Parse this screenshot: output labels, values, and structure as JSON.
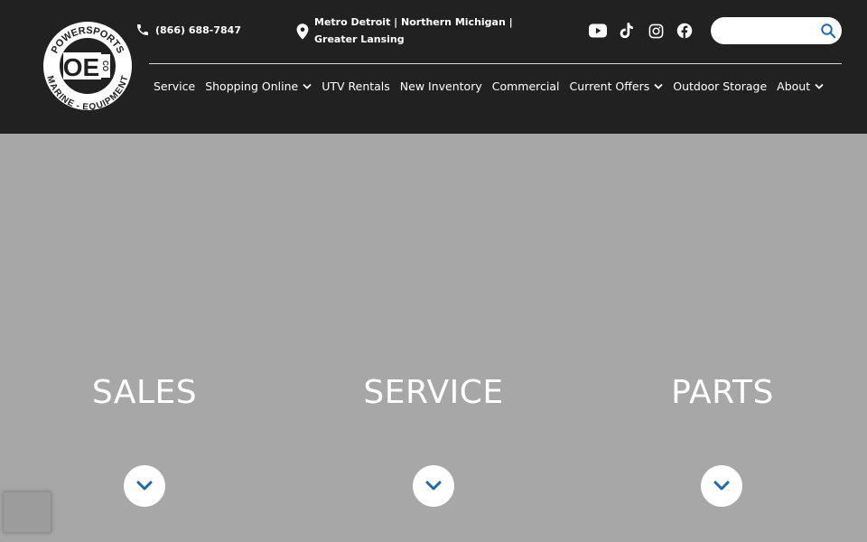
{
  "header": {
    "logo": {
      "ring_text_top": "POWERSPORTS",
      "ring_text_bottom": "MARINE - EQUIPMENT",
      "monogram": "OE",
      "monogram_sub": "CO"
    },
    "phone": {
      "icon": "phone-icon",
      "text": "(866) 688-7847"
    },
    "location": {
      "icon": "map-pin-icon",
      "text": "Metro Detroit | Northern Michigan | Greater Lansing"
    },
    "social": [
      {
        "name": "youtube-icon"
      },
      {
        "name": "tiktok-icon"
      },
      {
        "name": "instagram-icon"
      },
      {
        "name": "facebook-icon"
      }
    ],
    "search": {
      "placeholder": "",
      "value": "",
      "icon": "search-icon"
    }
  },
  "nav": {
    "items": [
      {
        "label": "Service",
        "dropdown": false
      },
      {
        "label": "Shopping Online",
        "dropdown": true
      },
      {
        "label": "UTV Rentals",
        "dropdown": false
      },
      {
        "label": "New Inventory",
        "dropdown": false
      },
      {
        "label": "Commercial",
        "dropdown": false
      },
      {
        "label": "Current Offers",
        "dropdown": true
      },
      {
        "label": "Outdoor Storage",
        "dropdown": false
      },
      {
        "label": "About",
        "dropdown": true
      }
    ]
  },
  "hero": {
    "tiles": [
      {
        "label": "SALES",
        "icon": "chevron-down-icon"
      },
      {
        "label": "SERVICE",
        "icon": "chevron-down-icon"
      },
      {
        "label": "PARTS",
        "icon": "chevron-down-icon"
      }
    ]
  },
  "colors": {
    "header_bg": "#212121",
    "hero_bg": "#a7a7a7",
    "accent_blue": "#1f6aa6",
    "text_white": "#ffffff"
  }
}
